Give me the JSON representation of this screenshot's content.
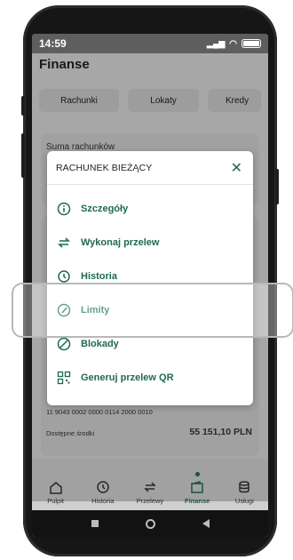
{
  "status": {
    "time": "14:59"
  },
  "app": {
    "title": "Finanse"
  },
  "tabs": [
    {
      "label": "Rachunki"
    },
    {
      "label": "Lokaty"
    },
    {
      "label": "Kredy"
    }
  ],
  "summary": {
    "label": "Suma rachunków"
  },
  "account": {
    "number": "11 9043 0002 0000 0114 2000 0010",
    "available_label": "Dostępne środki",
    "available_value": "55 151,10 PLN"
  },
  "modal": {
    "title": "RACHUNEK BIEŻĄCY",
    "items": [
      {
        "label": "Szczegóły",
        "icon": "info-icon"
      },
      {
        "label": "Wykonaj przelew",
        "icon": "transfer-icon"
      },
      {
        "label": "Historia",
        "icon": "history-icon"
      },
      {
        "label": "Limity",
        "icon": "gauge-icon"
      },
      {
        "label": "Blokady",
        "icon": "block-icon"
      },
      {
        "label": "Generuj przelew QR",
        "icon": "qr-icon"
      }
    ]
  },
  "bottom_nav": [
    {
      "label": "Pulpit",
      "icon": "home-icon"
    },
    {
      "label": "Historia",
      "icon": "history-icon"
    },
    {
      "label": "Przelewy",
      "icon": "transfer-icon"
    },
    {
      "label": "Finanse",
      "icon": "wallet-icon",
      "active": true
    },
    {
      "label": "Usługi",
      "icon": "database-icon"
    }
  ],
  "colors": {
    "accent": "#1f6a4f"
  }
}
